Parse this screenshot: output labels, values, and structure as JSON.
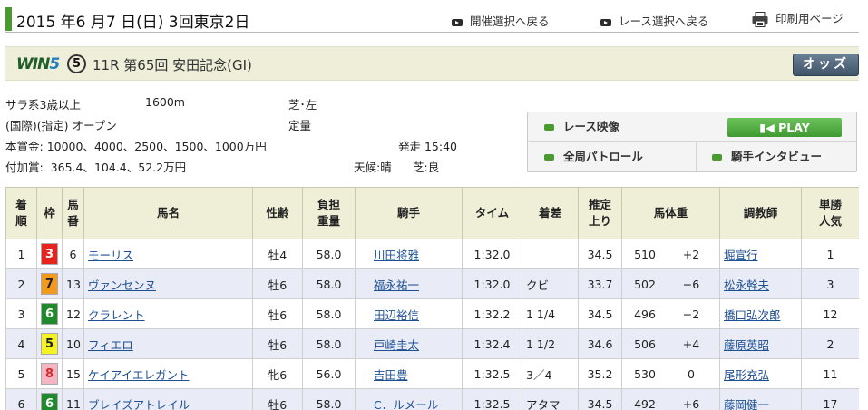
{
  "header": {
    "date": "2015 年6 月7 日(日) 3回東京2日",
    "links": [
      "開催選択へ戻る",
      "レース選択へ戻る",
      "印刷用ページ"
    ]
  },
  "race": {
    "win5_logo": "WIN5",
    "win5_number": "⑤",
    "title": "11R 第65回 安田記念(GI)",
    "odds_label": "オッズ"
  },
  "info": {
    "class": "サラ系3歳以上",
    "distance": "1600m",
    "surface": "芝･左",
    "condition": "(国際)(指定) オープン",
    "weight_rule": "定量",
    "prize_label": "本賞金:",
    "prize": "10000、4000、2500、1500、1000万円",
    "start": "発走 15:40",
    "bonus_label": "付加賞:",
    "bonus": "365.4、104.4、52.2万円",
    "weather": "天候:晴",
    "going": "芝:良"
  },
  "media": {
    "video": "レース映像",
    "play": "PLAY",
    "patrol": "全周パトロール",
    "interview": "騎手インタビュー"
  },
  "table": {
    "headers": [
      "着\n順",
      "枠",
      "馬\n番",
      "馬名",
      "性齢",
      "負担\n重量",
      "騎手",
      "タイム",
      "着差",
      "推定\n上り",
      "馬体重",
      "調教師",
      "単勝\n人気"
    ],
    "rows": [
      {
        "pos": "1",
        "waku": "3",
        "num": "6",
        "horse": "モーリス",
        "sexage": "牡4",
        "weight": "58.0",
        "jockey": "川田将雅",
        "time": "1:32.0",
        "margin": "",
        "last3f": "34.5",
        "bw": "510",
        "bwd": "+2",
        "trainer": "堀宣行",
        "pop": "1"
      },
      {
        "pos": "2",
        "waku": "7",
        "num": "13",
        "horse": "ヴァンセンヌ",
        "sexage": "牡6",
        "weight": "58.0",
        "jockey": "福永祐一",
        "time": "1:32.0",
        "margin": "クビ",
        "last3f": "33.7",
        "bw": "502",
        "bwd": "−6",
        "trainer": "松永幹夫",
        "pop": "3"
      },
      {
        "pos": "3",
        "waku": "6",
        "num": "12",
        "horse": "クラレント",
        "sexage": "牡6",
        "weight": "58.0",
        "jockey": "田辺裕信",
        "time": "1:32.2",
        "margin": "1 1/4",
        "last3f": "34.5",
        "bw": "496",
        "bwd": "−2",
        "trainer": "橋口弘次郎",
        "pop": "12"
      },
      {
        "pos": "4",
        "waku": "5",
        "num": "10",
        "horse": "フィエロ",
        "sexage": "牡6",
        "weight": "58.0",
        "jockey": "戸崎圭太",
        "time": "1:32.4",
        "margin": "1 1/2",
        "last3f": "34.6",
        "bw": "506",
        "bwd": "+4",
        "trainer": "藤原英昭",
        "pop": "2"
      },
      {
        "pos": "5",
        "waku": "8",
        "num": "15",
        "horse": "ケイアイエレガント",
        "sexage": "牝6",
        "weight": "56.0",
        "jockey": "吉田豊",
        "time": "1:32.5",
        "margin": "3／4",
        "last3f": "35.2",
        "bw": "530",
        "bwd": "0",
        "trainer": "尾形充弘",
        "pop": "11"
      },
      {
        "pos": "6",
        "waku": "6",
        "num": "11",
        "horse": "ブレイズアトレイル",
        "sexage": "牡6",
        "weight": "58.0",
        "jockey": "C．ルメール",
        "time": "1:32.5",
        "margin": "アタマ",
        "last3f": "34.5",
        "bw": "492",
        "bwd": "+6",
        "trainer": "藤岡健一",
        "pop": "17"
      }
    ]
  },
  "colors": {
    "waku_3": "#e8231e",
    "waku_5": "#f5f224",
    "waku_6": "#1f8a2c",
    "waku_7": "#f39a1e",
    "waku_8": "#f4b6c2",
    "header_bg": "#efefd8",
    "row_alt": "#e9ecf7",
    "link": "#1d4f93",
    "accent_green": "#4a9b2f"
  }
}
